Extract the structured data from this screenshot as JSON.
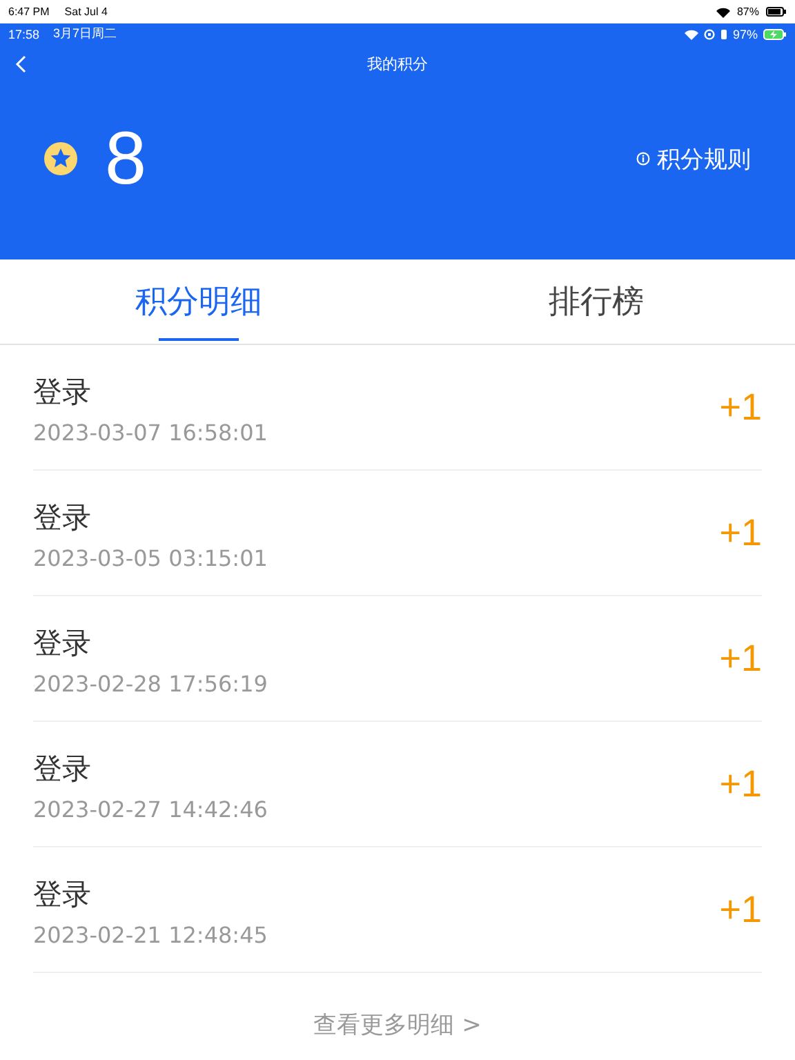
{
  "device_status_bar": {
    "time": "6:47 PM",
    "date": "Sat Jul 4",
    "battery": "87%"
  },
  "app_status_bar": {
    "time": "17:58",
    "date": "3月7日周二",
    "battery": "97%"
  },
  "nav": {
    "title": "我的积分"
  },
  "points": {
    "value": "8",
    "rules_link": "积分规则"
  },
  "tabs": [
    {
      "label": "积分明细",
      "selected": true
    },
    {
      "label": "排行榜",
      "selected": false
    }
  ],
  "records": [
    {
      "title": "登录",
      "time": "2023-03-07 16:58:01",
      "points": "+1"
    },
    {
      "title": "登录",
      "time": "2023-03-05 03:15:01",
      "points": "+1"
    },
    {
      "title": "登录",
      "time": "2023-02-28 17:56:19",
      "points": "+1"
    },
    {
      "title": "登录",
      "time": "2023-02-27 14:42:46",
      "points": "+1"
    },
    {
      "title": "登录",
      "time": "2023-02-21 12:48:45",
      "points": "+1"
    }
  ],
  "more_link": "查看更多明细 >"
}
